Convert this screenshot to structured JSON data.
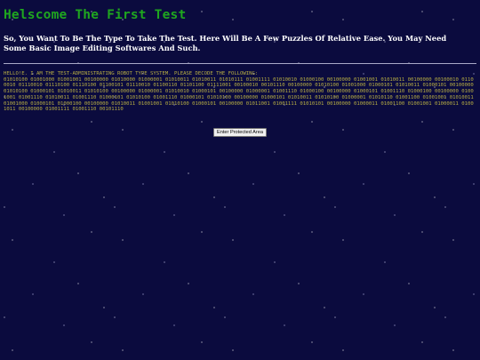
{
  "page": {
    "title": "Helscome The First Test",
    "intro": "So, You Want To Be The Type To Take The Test. Here Will Be A Few Puzzles Of Relative Ease. You May Need Some Basic Image Editing Softwares And Such.",
    "robot_heading": "HELLO!E. I AM THE TEST-ADMINISTRATING ROBOT TYPE SYSTEM. PLEASE DECODE THE FOLLOWING:",
    "binary": "01010100 01001000 01001001 00100000 01010000 01000001 01010011 01010011 01010111 01001111 01010010 01000100 00100000 01001001 01010011 00100000 00100010 01100010 01110010 01110100 01110100 01100101 01110010 01100110 01101100 01111001 00100010 00101110 00100000 01010100 01001000 01000101 01010011 01000101 00100000 01010100 01000101 01010011 01010100 00100000 01000001 01010010 01000101 00100000 01000001 01001110 01000100 00100000 01000101 01001110 01000100 00100000 01001001 01001110 01010011 01001110 01000101 01010100 01001110 01000101 01010100 00100000 01000101 01010011 01010100 01000001 01010110 01001100 01001001 01010011 01001000 01000101 01000100 00100000 01010011 01001001 01010100 01000101 00100000 01011001 01001111 01010101 00100000 01000011 01001100 01001001 01000011 01001011 00100000 01001111 01001110 00101110"
  },
  "button": {
    "label": "Enter Protected Area"
  },
  "colors": {
    "background": "#0b0b3e",
    "title": "#1fa61f",
    "robot_text": "#b7ad43",
    "body_text": "#ffffff"
  }
}
